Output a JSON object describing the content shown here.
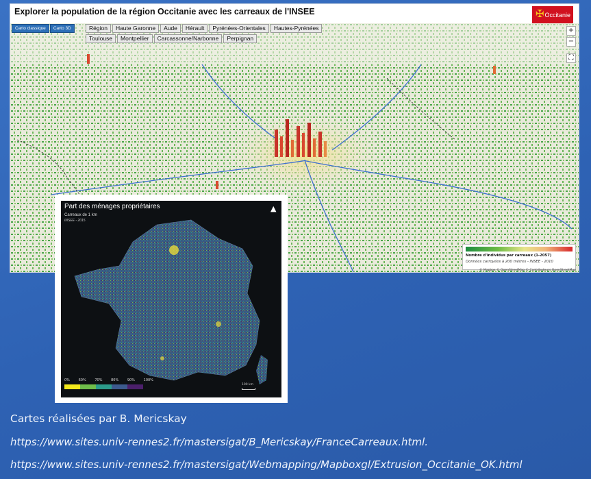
{
  "map3d": {
    "title": "Explorer la population de la région Occitanie avec les carreaux de l'INSEE",
    "logo_text": "Occitanie",
    "mode_tabs": [
      "Carto classique",
      "Carto 3D"
    ],
    "regions": [
      "Région",
      "Haute Garonne",
      "Aude",
      "Hérault",
      "Pyrénées-Orientales",
      "Hautes-Pyrénées",
      "Toulouse",
      "Montpellier",
      "Carcassonne/Narbonne",
      "Perpignan"
    ],
    "zoom_in": "+",
    "zoom_out": "−",
    "fullscreen": "⛶",
    "legend_title": "Nombre d'individus par carreaux (1-2057)",
    "legend_source": "Données carroyées à 200 mètres - INSEE - 2010",
    "attribution": "© Mapbox © OpenStreetMap © Contributeurs OpenStreetMap"
  },
  "inset": {
    "title": "Part des ménages propriétaires",
    "subtitle": "Carreaux de 1 km",
    "source": "INSEE - 2015",
    "legend_labels": [
      "0%",
      "60%",
      "70%",
      "80%",
      "90%",
      "100%"
    ],
    "legend_colors": [
      "#f3e91c",
      "#6fbd4a",
      "#2c9b8b",
      "#3c5a8e",
      "#4b1f6a"
    ],
    "scale_label": "100 km",
    "north_arrow": "north-arrow-icon"
  },
  "caption": {
    "line1": "Cartes réalisées par B. Mericskay",
    "line2": "https://www.sites.univ-rennes2.fr/mastersigat/B_Mericskay/FranceCarreaux.html.",
    "line3": "https://www.sites.univ-rennes2.fr/mastersigat/Webmapping/Mapboxgl/Extrusion_Occitanie_OK.html"
  }
}
